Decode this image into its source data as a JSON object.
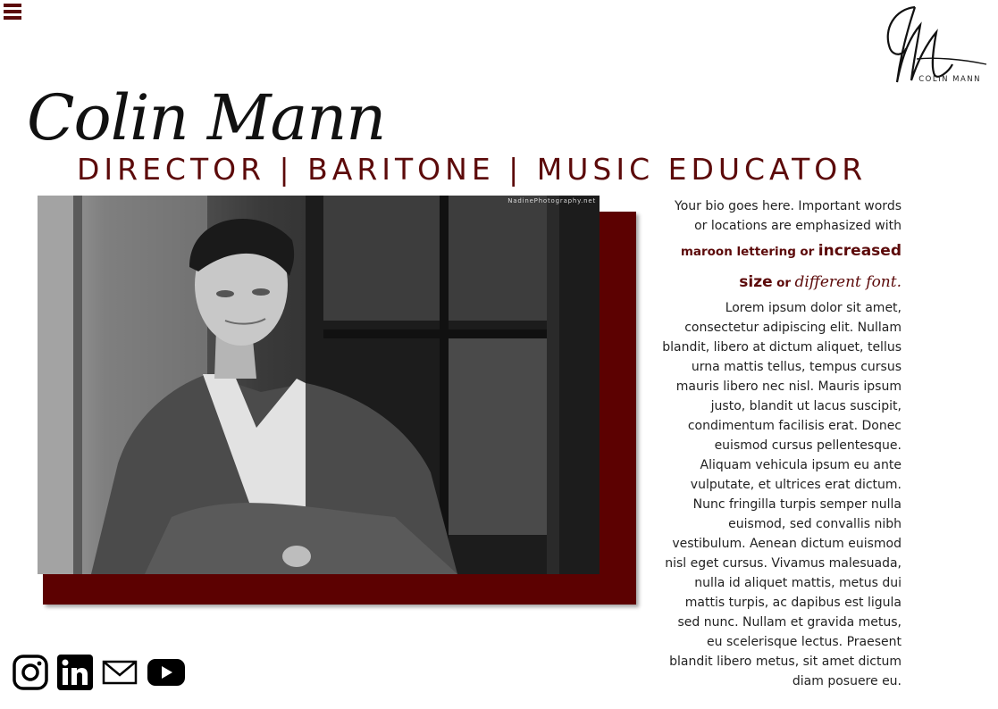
{
  "header": {
    "menu_icon": "hamburger-menu-icon",
    "logo_text": "COLIN MANN"
  },
  "hero": {
    "signature": "Colin Mann",
    "tagline": "DIRECTOR | BARITONE | MUSIC EDUCATOR"
  },
  "photo": {
    "watermark": "NadinePhotography.net"
  },
  "bio": {
    "intro": "Your bio goes here. Important words or locations are emphasized with",
    "emphasis_color_text": "maroon lettering",
    "or_1": "or",
    "emphasis_size_text": "increased size",
    "or_2": "or",
    "emphasis_font_text": "different font.",
    "body": "Lorem ipsum dolor sit amet, consectetur adipiscing elit. Nullam blandit, libero at dictum aliquet, tellus urna mattis tellus, tempus cursus mauris libero nec nisl. Mauris ipsum justo, blandit ut lacus suscipit, condimentum facilisis erat. Donec euismod cursus pellentesque. Aliquam vehicula ipsum eu ante vulputate, et ultrices erat dictum. Nunc fringilla turpis semper nulla euismod, sed convallis nibh vestibulum. Aenean dictum euismod nisl eget cursus. Vivamus malesuada, nulla id aliquet mattis, metus dui mattis turpis, ac dapibus est ligula sed nunc. Nullam et gravida metus, eu scelerisque lectus. Praesent blandit libero metus, sit amet dictum diam posuere eu."
  },
  "social": [
    {
      "icon": "instagram-icon"
    },
    {
      "icon": "linkedin-icon"
    },
    {
      "icon": "email-icon"
    },
    {
      "icon": "youtube-icon"
    }
  ],
  "colors": {
    "accent": "#5c0a0a",
    "photo_backdrop": "#5c0101"
  }
}
